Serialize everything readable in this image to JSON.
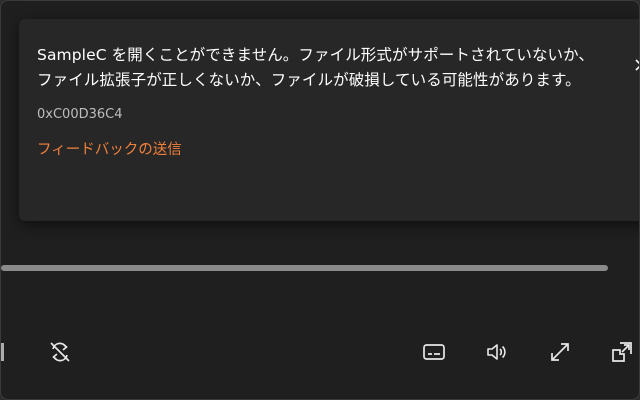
{
  "error": {
    "message": "SampleC を開くことができません。ファイル形式がサポートされていないか、ファイル拡張子が正しくないか、ファイルが破損している可能性があります。",
    "code": "0xC00D36C4",
    "feedback_label": "フィードバックの送信",
    "link_color": "#f0813c"
  },
  "icons": {
    "close": "close-icon",
    "repeat_off": "repeat-off-icon",
    "subtitles": "subtitles-icon",
    "volume": "volume-icon",
    "fullscreen": "fullscreen-icon",
    "mini_player": "mini-player-icon"
  },
  "colors": {
    "background": "#1f1f1f",
    "banner": "#272727",
    "seek_track": "#8a8a8a"
  }
}
